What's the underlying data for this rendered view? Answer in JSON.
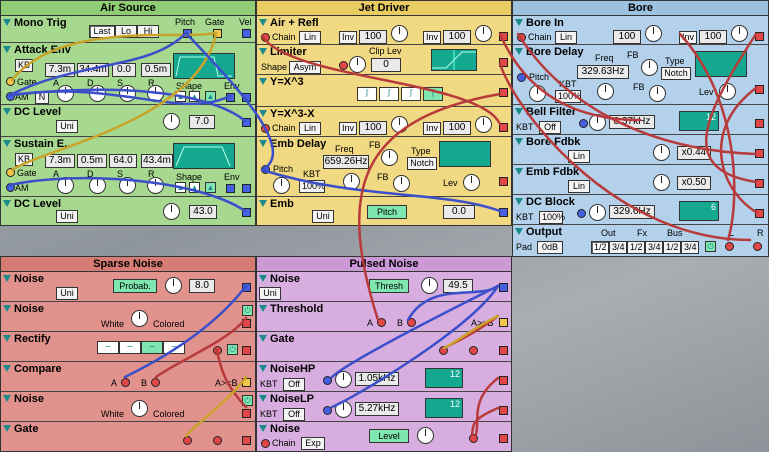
{
  "air": {
    "title": "Air Source",
    "mono": {
      "name": "Mono Trig",
      "pitch": "Pitch",
      "gate": "Gate",
      "vel": "Vel",
      "opts": [
        "Last",
        "Lo",
        "Hi"
      ]
    },
    "attack": {
      "name": "Attack Env",
      "kb": "KB",
      "gate": "Gate",
      "am": "AM",
      "n": "N",
      "vals": [
        "7.3m",
        "34.4m",
        "0.0",
        "0.5m"
      ],
      "adsr": [
        "A",
        "D",
        "S",
        "R"
      ],
      "shape": "Shape",
      "env": "Env"
    },
    "dc1": {
      "name": "DC Level",
      "mode": "Uni",
      "val": "7.0"
    },
    "sustain": {
      "name": "Sustain E..",
      "kb": "KB",
      "gate": "Gate",
      "am": "AM",
      "vals": [
        "7.3m",
        "0.5m",
        "64.0",
        "43.4m"
      ],
      "adsr": [
        "A",
        "D",
        "S",
        "R"
      ],
      "shape": "Shape",
      "env": "Env"
    },
    "dc2": {
      "name": "DC Level",
      "mode": "Uni",
      "val": "43.0"
    }
  },
  "jet": {
    "title": "Jet Driver",
    "airrefl": {
      "name": "Air + Refl",
      "chain": "Chain",
      "lin": "Lin",
      "inv": "Inv",
      "v1": "100",
      "inv2": "Inv",
      "v2": "100"
    },
    "limiter": {
      "name": "Limiter",
      "shape_lbl": "Shape",
      "shape": "Asym",
      "clip_lbl": "Clip Lev",
      "clip": "0"
    },
    "yx3": {
      "name": "Y=X^3"
    },
    "yx3x": {
      "name": "Y=X^3-X",
      "chain": "Chain",
      "lin": "Lin",
      "inv": "Inv",
      "v1": "100",
      "inv2": "Inv",
      "v2": "100"
    },
    "embdelay": {
      "name": "Emb Delay",
      "pitch": "Pitch",
      "kbt": "KBT",
      "kbt_val": "100%",
      "freq_lbl": "Freq",
      "freq": "659.26Hz",
      "fb": "FB",
      "fb2": "FB",
      "type_lbl": "Type",
      "type": "Notch",
      "lev": "Lev"
    },
    "emb": {
      "name": "Emb",
      "mode": "Uni",
      "pitch": "Pitch",
      "val": "0.0"
    }
  },
  "bore": {
    "title": "Bore",
    "borein": {
      "name": "Bore In",
      "chain": "Chain",
      "lin": "Lin",
      "v1": "100",
      "inv": "Inv",
      "v2": "100"
    },
    "boredelay": {
      "name": "Bore Delay",
      "pitch": "Pitch",
      "kbt": "KBT",
      "kbt_val": "100%",
      "freq_lbl": "Freq",
      "freq": "329.63Hz",
      "fb": "FB",
      "fb2": "FB",
      "type_lbl": "Type",
      "type": "Notch",
      "lev": "Lev"
    },
    "bellfilter": {
      "name": "Bell Filter",
      "kbt": "KBT",
      "kbt_val": "Off",
      "freq": "8.37kHz",
      "slope": "12"
    },
    "borefdbk": {
      "name": "Bore Fdbk",
      "mode": "Lin",
      "val": "x0.44"
    },
    "embfdbk": {
      "name": "Emb Fdbk",
      "mode": "Lin",
      "val": "x0.50"
    },
    "dcblock": {
      "name": "DC Block",
      "kbt": "KBT",
      "kbt_val": "100%",
      "freq": "329.6Hz",
      "slope": "6"
    },
    "output": {
      "name": "Output",
      "pad": "Pad",
      "pad_val": "0dB",
      "out": "Out",
      "fx": "Fx",
      "bus": "Bus",
      "opts": [
        "1/2",
        "3/4",
        "1/2",
        "3/4",
        "1/2",
        "3/4"
      ],
      "l": "L",
      "r": "R"
    }
  },
  "sparse": {
    "title": "Sparse Noise",
    "noise1": {
      "name": "Noise",
      "mode": "Uni",
      "prob": "Probab.",
      "val": "8.0"
    },
    "noise2": {
      "name": "Noise",
      "white": "White",
      "colored": "Colored"
    },
    "rectify": {
      "name": "Rectify"
    },
    "compare": {
      "name": "Compare",
      "a": "A",
      "b": "B",
      "ab": "A>=B"
    },
    "noise3": {
      "name": "Noise",
      "white": "White",
      "colored": "Colored"
    },
    "gate": {
      "name": "Gate"
    }
  },
  "pulsed": {
    "title": "Pulsed Noise",
    "noise": {
      "name": "Noise",
      "mode": "Uni",
      "thresh": "Thresh",
      "val": "49.5"
    },
    "threshold": {
      "name": "Threshold",
      "a": "A",
      "b": "B",
      "ab": "A>=B"
    },
    "gate": {
      "name": "Gate"
    },
    "noisehp": {
      "name": "NoiseHP",
      "kbt": "KBT",
      "kbt_val": "Off",
      "freq": "1.05kHz",
      "slope": "12"
    },
    "noiselp": {
      "name": "NoiseLP",
      "kbt": "KBT",
      "kbt_val": "Off",
      "freq": "5.27kHz",
      "slope": "12"
    },
    "noise2": {
      "name": "Noise",
      "chain": "Chain",
      "exp": "Exp",
      "level": "Level"
    }
  }
}
